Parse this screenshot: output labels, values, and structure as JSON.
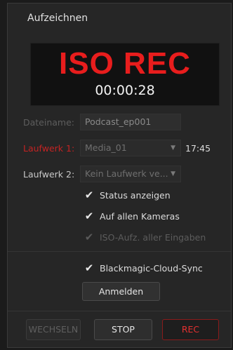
{
  "panel": {
    "title": "Aufzeichnen"
  },
  "display": {
    "status": "ISO REC",
    "timecode": "00:00:28"
  },
  "filename": {
    "label": "Dateiname:",
    "value": "Podcast_ep001"
  },
  "drive1": {
    "label": "Laufwerk 1:",
    "value": "Media_01",
    "time": "17:45"
  },
  "drive2": {
    "label": "Laufwerk 2:",
    "value": "Kein Laufwerk ve..."
  },
  "options": {
    "show_status": "Status anzeigen",
    "all_cameras": "Auf allen Kameras",
    "iso_all_inputs": "ISO-Aufz. aller Eingaben",
    "cloud_sync": "Blackmagic-Cloud-Sync",
    "login": "Anmelden"
  },
  "buttons": {
    "switch": "WECHSELN",
    "stop": "STOP",
    "rec": "REC"
  },
  "colors": {
    "accent_red": "#e81d1d",
    "panel_bg": "#262626"
  },
  "icons": {
    "checkmark": "✔",
    "dropdown": "▼"
  }
}
